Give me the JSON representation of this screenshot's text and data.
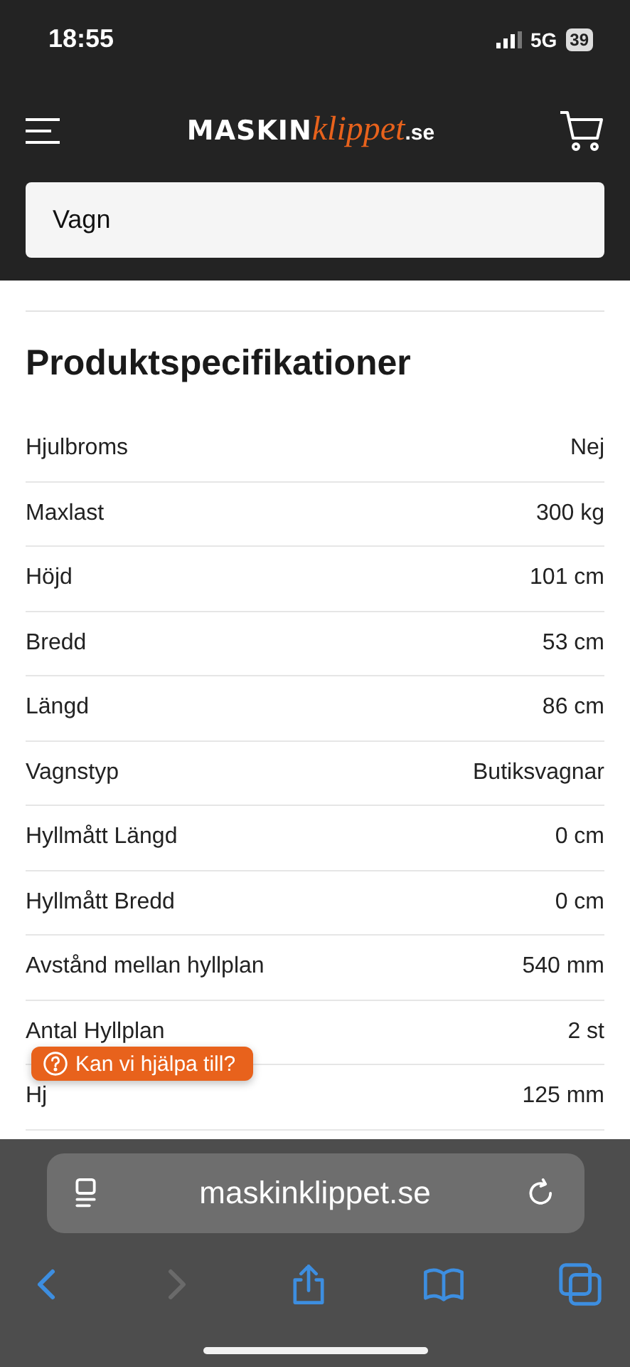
{
  "status_bar": {
    "time": "18:55",
    "network": "5G",
    "battery": "39"
  },
  "header": {
    "logo": {
      "main": "MASKIN",
      "script": "klippet",
      "suffix": ".se"
    }
  },
  "search": {
    "value": "Vagn"
  },
  "specs": {
    "title": "Produktspecifikationer",
    "rows": [
      {
        "label": "Hjulbroms",
        "value": "Nej"
      },
      {
        "label": "Maxlast",
        "value": "300 kg"
      },
      {
        "label": "Höjd",
        "value": "101 cm"
      },
      {
        "label": "Bredd",
        "value": "53 cm"
      },
      {
        "label": "Längd",
        "value": "86 cm"
      },
      {
        "label": "Vagnstyp",
        "value": "Butiksvagnar"
      },
      {
        "label": "Hyllmått Längd",
        "value": "0 cm"
      },
      {
        "label": "Hyllmått Bredd",
        "value": "0 cm"
      },
      {
        "label": "Avstånd mellan hyllplan",
        "value": "540 mm"
      },
      {
        "label": "Antal Hyllplan",
        "value": "2 st"
      },
      {
        "label": "Hj",
        "value": "125 mm"
      }
    ]
  },
  "help_button": {
    "label": "Kan vi hjälpa till?"
  },
  "browser": {
    "url": "maskinklippet.se",
    "back_disabled": false,
    "forward_disabled": true
  }
}
